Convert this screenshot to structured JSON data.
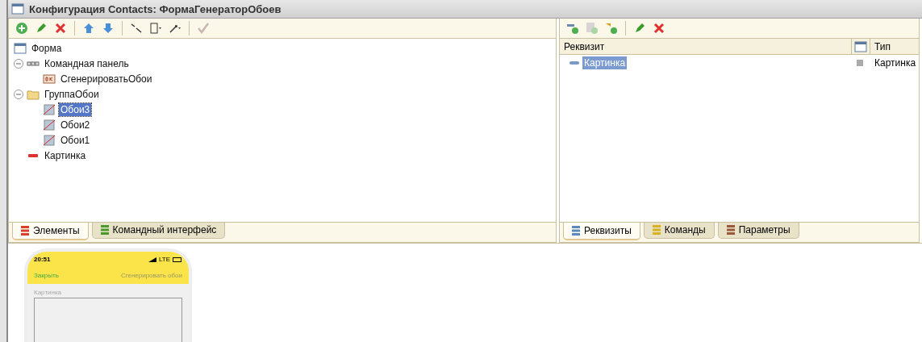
{
  "window": {
    "title": "Конфигурация Contacts: ФормаГенераторОбоев"
  },
  "left_toolbar": [
    {
      "kind": "add",
      "disabled": false
    },
    {
      "kind": "edit",
      "disabled": false
    },
    {
      "kind": "delete",
      "disabled": false
    },
    {
      "kind": "sep"
    },
    {
      "kind": "up",
      "disabled": false
    },
    {
      "kind": "down",
      "disabled": false
    },
    {
      "kind": "sep"
    },
    {
      "kind": "swap",
      "disabled": false
    },
    {
      "kind": "device",
      "disabled": false
    },
    {
      "kind": "resize",
      "disabled": false
    },
    {
      "kind": "sep"
    },
    {
      "kind": "check",
      "disabled": true
    }
  ],
  "tree": [
    {
      "label": "Форма",
      "kind": "form",
      "selected": false,
      "children": [
        {
          "label": "Командная панель",
          "kind": "panel",
          "expanded": true,
          "selected": false,
          "children": [
            {
              "label": "СгенерироватьОбои",
              "kind": "button",
              "selected": false
            }
          ]
        },
        {
          "label": "ГруппаОбои",
          "kind": "folder",
          "expanded": true,
          "selected": false,
          "children": [
            {
              "label": "Обои3",
              "kind": "picture",
              "selected": true
            },
            {
              "label": "Обои2",
              "kind": "picture",
              "selected": false
            },
            {
              "label": "Обои1",
              "kind": "picture",
              "selected": false
            }
          ]
        },
        {
          "label": "Картинка",
          "kind": "field",
          "selected": false
        }
      ]
    }
  ],
  "left_tabs": [
    {
      "label": "Элементы",
      "selected": true,
      "color": "#d8402c"
    },
    {
      "label": "Командный интерфейс",
      "selected": false,
      "color": "#4a9a2c"
    }
  ],
  "right_toolbar": [
    {
      "kind": "add-attr",
      "disabled": false
    },
    {
      "kind": "add-table",
      "disabled": true
    },
    {
      "kind": "add-link",
      "disabled": false
    },
    {
      "kind": "sep"
    },
    {
      "kind": "edit",
      "disabled": false
    },
    {
      "kind": "delete",
      "disabled": false
    }
  ],
  "attributes": {
    "columns": [
      "Реквизит",
      "Тип"
    ],
    "rows": [
      {
        "name": "Картинка",
        "type": "Картинка",
        "selected": true
      }
    ]
  },
  "right_tabs": [
    {
      "label": "Реквизиты",
      "selected": true,
      "color": "#5a8ac0"
    },
    {
      "label": "Команды",
      "selected": false,
      "color": "#d8b020"
    },
    {
      "label": "Параметры",
      "selected": false,
      "color": "#9a5a3a"
    }
  ],
  "preview": {
    "time": "20:51",
    "network": "LTE",
    "close": "Закрыть",
    "action": "Сгенерировать обои",
    "field_label": "Картинка"
  }
}
